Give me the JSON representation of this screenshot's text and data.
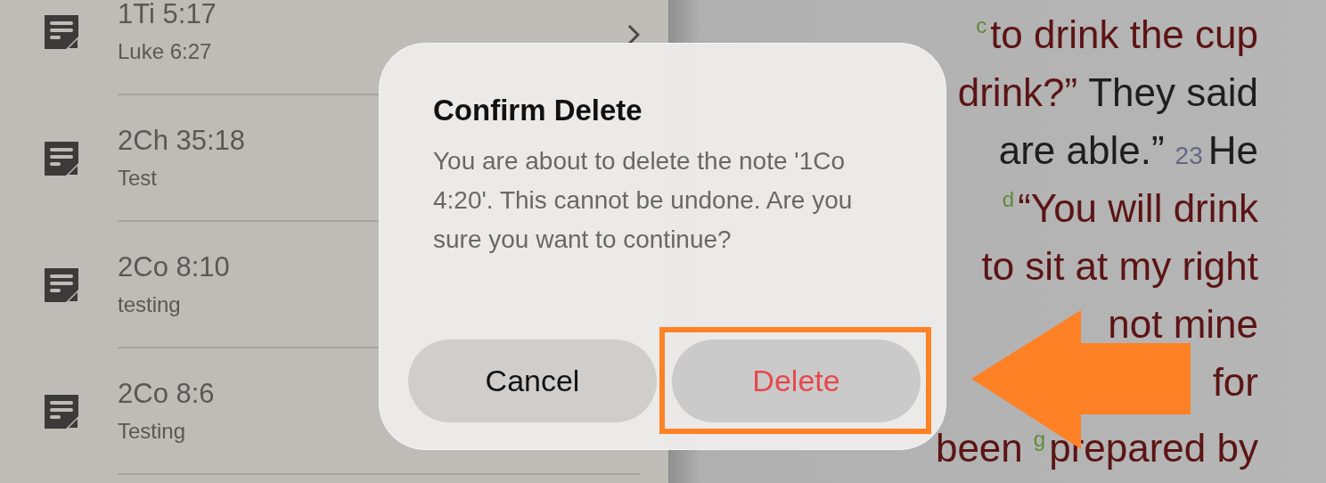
{
  "notes": [
    {
      "title": "1Ti 5:17",
      "subtitle": "Luke 6:27",
      "chevron": true
    },
    {
      "title": "2Ch 35:18",
      "subtitle": "Test"
    },
    {
      "title": "2Co 8:10",
      "subtitle": "testing"
    },
    {
      "title": "2Co 8:6",
      "subtitle": "Testing"
    }
  ],
  "reading": [
    [
      {
        "kind": "note",
        "text": "c"
      },
      {
        "kind": "red",
        "text": "to drink the cup"
      }
    ],
    [
      {
        "kind": "red",
        "text": "drink?”"
      },
      {
        "kind": "plain",
        "text": "They said"
      }
    ],
    [
      {
        "kind": "plain",
        "text": "are able.”"
      },
      {
        "kind": "verse",
        "text": "23"
      },
      {
        "kind": "plain",
        "text": "He"
      }
    ],
    [
      {
        "kind": "note",
        "text": "d"
      },
      {
        "kind": "red",
        "text": "“You will drink"
      }
    ],
    [
      {
        "kind": "red",
        "text": "to sit at my right"
      }
    ],
    [
      {
        "kind": "red",
        "text": "not mine"
      }
    ],
    [
      {
        "kind": "red",
        "text": "for"
      }
    ],
    [
      {
        "kind": "red",
        "text": "been"
      },
      {
        "kind": "note",
        "text": "g"
      },
      {
        "kind": "red",
        "text": "prepared by"
      }
    ]
  ],
  "dialog": {
    "title": "Confirm Delete",
    "message": "You are about to delete the note '1Co 4:20'. This cannot be undone. Are you sure you want to continue?",
    "buttons": [
      {
        "label": "Cancel",
        "kind": "cancel"
      },
      {
        "label": "Delete",
        "kind": "destructive"
      }
    ]
  }
}
